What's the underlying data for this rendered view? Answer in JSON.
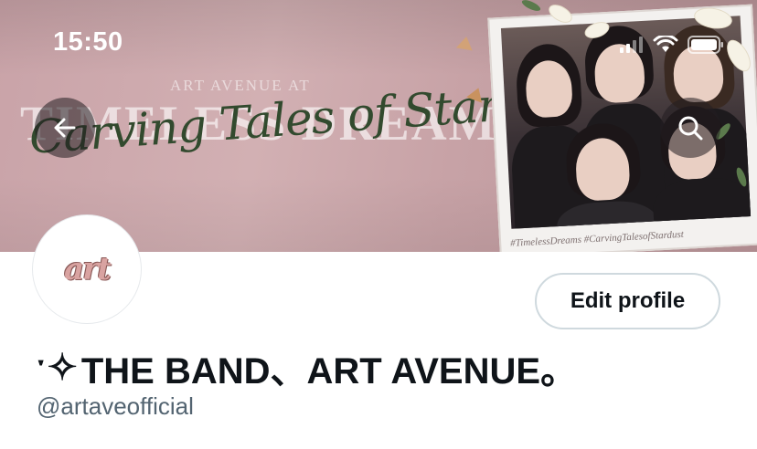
{
  "status_bar": {
    "time": "15:50",
    "icons": [
      "cellular-signal-icon",
      "wifi-icon",
      "battery-icon"
    ]
  },
  "banner": {
    "pretitle": "ART AVENUE AT",
    "title": "TIMELESS DREAMS",
    "script": "Carving Tales of Stardust",
    "hashtags": "#TimelessDreams  #CarvingTalesofStardust"
  },
  "nav": {
    "back_icon": "arrow-left-icon",
    "search_icon": "search-icon"
  },
  "profile": {
    "avatar_logo": "art",
    "edit_button_label": "Edit profile",
    "display_name_prefix": "ˑ✧",
    "display_name": "THE BAND、ART AVENUE。",
    "handle": "@artaveofficial"
  },
  "colors": {
    "text_primary": "#0f1419",
    "text_secondary": "#536471",
    "button_border": "#cfd9de",
    "banner_pink": "#c9a3a8",
    "script_green": "#324a2e"
  }
}
